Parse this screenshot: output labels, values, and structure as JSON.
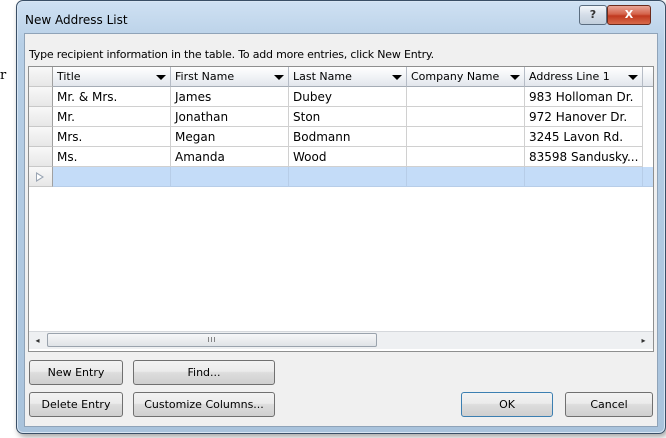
{
  "background_letter": "r",
  "window": {
    "title": "New Address List",
    "help_glyph": "?",
    "close_glyph": "X"
  },
  "instruction": "Type recipient information in the table.  To add more entries, click New Entry.",
  "table": {
    "columns": [
      "Title",
      "First Name",
      "Last Name",
      "Company Name",
      "Address Line 1"
    ],
    "rows": [
      [
        "Mr. & Mrs.",
        "James",
        "Dubey",
        "",
        "983 Holloman Dr."
      ],
      [
        "Mr.",
        "Jonathan",
        "Ston",
        "",
        "972 Hanover Dr."
      ],
      [
        "Mrs.",
        "Megan",
        "Bodmann",
        "",
        "3245 Lavon Rd."
      ],
      [
        "Ms.",
        "Amanda",
        "Wood",
        "",
        "83598 Sandusky..."
      ]
    ]
  },
  "scrollbar": {
    "left_arrow": "◂",
    "right_arrow": "▸",
    "thumb_grip": "III"
  },
  "buttons": {
    "new_entry": "New Entry",
    "find": "Find...",
    "delete_entry": "Delete Entry",
    "customize_columns": "Customize Columns...",
    "ok": "OK",
    "cancel": "Cancel"
  },
  "colors": {
    "new_row_highlight": "#c4dcf8",
    "close_button": "#c0391f"
  }
}
